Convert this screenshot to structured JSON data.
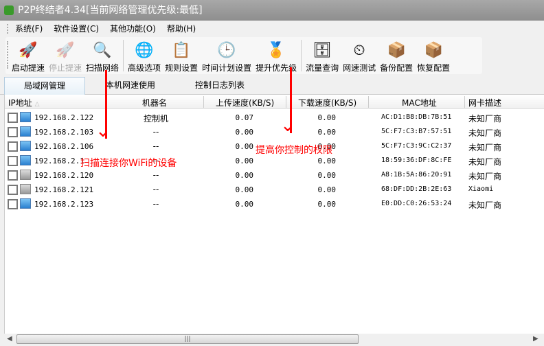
{
  "window": {
    "title": "P2P终结者4.34[当前网络管理优先级:最低]"
  },
  "menu": [
    "系统(F)",
    "软件设置(C)",
    "其他功能(O)",
    "帮助(H)"
  ],
  "toolbar": [
    {
      "label": "启动提速",
      "icon": "rocket-icon",
      "glyph": "🚀",
      "enabled": true
    },
    {
      "label": "停止提速",
      "icon": "rocket-disabled-icon",
      "glyph": "🚀",
      "enabled": false
    },
    {
      "label": "扫描网络",
      "icon": "magnifier-icon",
      "glyph": "🔍",
      "enabled": true
    },
    {
      "label": "高级选项",
      "icon": "globe-gear-icon",
      "glyph": "🌐",
      "enabled": true
    },
    {
      "label": "规则设置",
      "icon": "rules-key-icon",
      "glyph": "📋",
      "enabled": true
    },
    {
      "label": "时间计划设置",
      "icon": "clock-icon",
      "glyph": "🕒",
      "enabled": true
    },
    {
      "label": "提升优先级",
      "icon": "medal-icon",
      "glyph": "🏅",
      "enabled": true
    },
    {
      "label": "流量查询",
      "icon": "database-globe-icon",
      "glyph": "🗄",
      "enabled": true
    },
    {
      "label": "网速测试",
      "icon": "speedometer-icon",
      "glyph": "⏲",
      "enabled": true
    },
    {
      "label": "备份配置",
      "icon": "box-download-icon",
      "glyph": "📦",
      "enabled": true
    },
    {
      "label": "恢复配置",
      "icon": "box-restore-icon",
      "glyph": "📦",
      "enabled": true
    }
  ],
  "tabs": [
    "局域网管理",
    "本机网速使用",
    "控制日志列表"
  ],
  "columns": [
    "IP地址",
    "机器名",
    "上传速度(KB/S)",
    "下载速度(KB/S)",
    "MAC地址",
    "网卡描述"
  ],
  "rows": [
    {
      "ip": "192.168.2.122",
      "name": "控制机",
      "up": "0.07",
      "down": "0.00",
      "mac": "AC:D1:B8:DB:7B:51",
      "vendor": "未知厂商",
      "online": true
    },
    {
      "ip": "192.168.2.103",
      "name": "--",
      "up": "0.00",
      "down": "0.00",
      "mac": "5C:F7:C3:B7:57:51",
      "vendor": "未知厂商",
      "online": true
    },
    {
      "ip": "192.168.2.106",
      "name": "--",
      "up": "0.00",
      "down": "0.00",
      "mac": "5C:F7:C3:9C:C2:37",
      "vendor": "未知厂商",
      "online": true
    },
    {
      "ip": "192.168.2.1",
      "name": "--",
      "up": "0.00",
      "down": "0.00",
      "mac": "18:59:36:DF:8C:FE",
      "vendor": "未知厂商",
      "online": true
    },
    {
      "ip": "192.168.2.120",
      "name": "--",
      "up": "0.00",
      "down": "0.00",
      "mac": "A8:1B:5A:86:20:91",
      "vendor": "未知厂商",
      "online": false
    },
    {
      "ip": "192.168.2.121",
      "name": "--",
      "up": "0.00",
      "down": "0.00",
      "mac": "68:DF:DD:2B:2E:63",
      "vendor": "Xiaomi",
      "online": false
    },
    {
      "ip": "192.168.2.123",
      "name": "--",
      "up": "0.00",
      "down": "0.00",
      "mac": "E0:DD:C0:26:53:24",
      "vendor": "未知厂商",
      "online": true
    }
  ],
  "annotations": {
    "scan": "扫描连接你WiFi的设备",
    "priority": "提高你控制的权限",
    "color": "#ff0000"
  }
}
